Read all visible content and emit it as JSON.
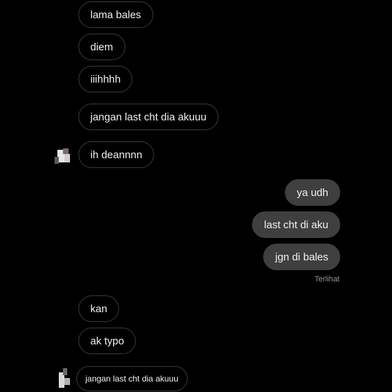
{
  "messages": [
    {
      "text": "lama bales",
      "direction": "incoming"
    },
    {
      "text": "diem",
      "direction": "incoming"
    },
    {
      "text": "iiihhhh",
      "direction": "incoming"
    },
    {
      "text": "jangan last cht dia akuuu",
      "direction": "incoming"
    },
    {
      "text": "ih deannnn",
      "direction": "incoming"
    },
    {
      "text": "ya udh",
      "direction": "outgoing"
    },
    {
      "text": "last cht di aku",
      "direction": "outgoing"
    },
    {
      "text": "jgn di bales",
      "direction": "outgoing"
    },
    {
      "text": "kan",
      "direction": "incoming"
    },
    {
      "text": "ak typo",
      "direction": "incoming"
    },
    {
      "text": "jangan last cht dia akuuu",
      "direction": "incoming"
    }
  ],
  "seen_label": "Terlihat",
  "colors": {
    "background": "#000000",
    "incoming_border": "#3a3a3a",
    "outgoing_bubble": "#3f3f3f",
    "text": "#f2f2f2",
    "seen_text": "#9a9a9a"
  }
}
